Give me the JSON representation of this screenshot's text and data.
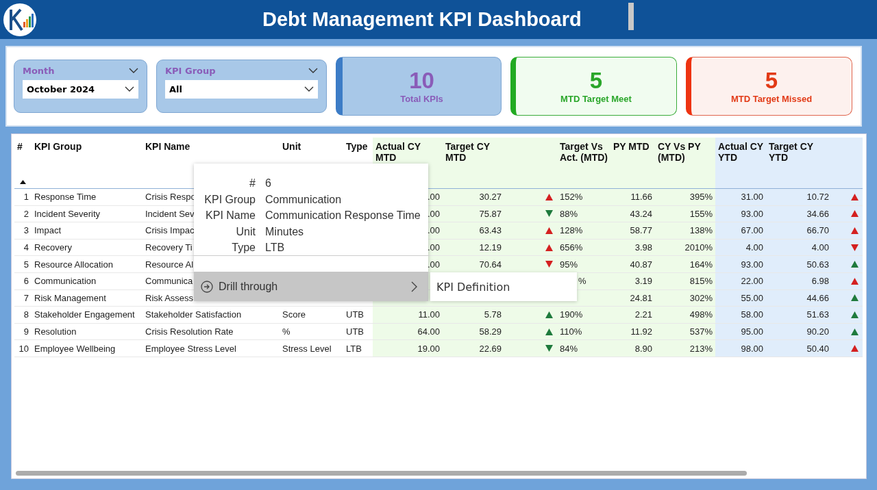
{
  "header": {
    "title": "Debt Management KPI Dashboard"
  },
  "slicers": [
    {
      "label": "Month",
      "value": "October 2024"
    },
    {
      "label": "KPI Group",
      "value": "All"
    }
  ],
  "cards": [
    {
      "kind": "total",
      "value": "10",
      "label": "Total KPIs"
    },
    {
      "kind": "met",
      "value": "5",
      "label": "MTD Target Meet"
    },
    {
      "kind": "missed",
      "value": "5",
      "label": "MTD Target Missed"
    }
  ],
  "table": {
    "columns": [
      {
        "label": "#",
        "sorted": true
      },
      {
        "label": "KPI Group"
      },
      {
        "label": "KPI Name"
      },
      {
        "label": "Unit"
      },
      {
        "label": "Type"
      },
      {
        "label": "Actual CY MTD"
      },
      {
        "label": "Target CY MTD"
      },
      {
        "label": "Target Vs Act. (MTD)"
      },
      {
        "label": "PY MTD"
      },
      {
        "label": "CY Vs PY (MTD)"
      },
      {
        "label": "Actual CY YTD"
      },
      {
        "label": "Target CY YTD"
      }
    ],
    "rows": [
      {
        "num": "1",
        "group": "Response Time",
        "name": "Crisis Respo",
        "actual_mtd": ".00",
        "target_mtd": "30.27",
        "mtd_up": true,
        "mtd_met": false,
        "target_vs_act": "152%",
        "py_mtd": "11.66",
        "cy_vs_py": "395%",
        "actual_ytd": "31.00",
        "target_ytd": "10.72",
        "ytd_up": true,
        "ytd_met": false
      },
      {
        "num": "2",
        "group": "Incident Severity",
        "name": "Incident Sev",
        "actual_mtd": ".00",
        "target_mtd": "75.87",
        "mtd_up": false,
        "mtd_met": true,
        "target_vs_act": "88%",
        "py_mtd": "43.24",
        "cy_vs_py": "155%",
        "actual_ytd": "93.00",
        "target_ytd": "34.66",
        "ytd_up": true,
        "ytd_met": false
      },
      {
        "num": "3",
        "group": "Impact",
        "name": "Crisis Impac",
        "actual_mtd": ".00",
        "target_mtd": "63.43",
        "mtd_up": true,
        "mtd_met": false,
        "target_vs_act": "128%",
        "py_mtd": "58.77",
        "cy_vs_py": "138%",
        "actual_ytd": "67.00",
        "target_ytd": "66.70",
        "ytd_up": true,
        "ytd_met": false
      },
      {
        "num": "4",
        "group": "Recovery",
        "name": "Recovery Ti",
        "actual_mtd": ".00",
        "target_mtd": "12.19",
        "mtd_up": true,
        "mtd_met": false,
        "target_vs_act": "656%",
        "py_mtd": "3.98",
        "cy_vs_py": "2010%",
        "actual_ytd": "4.00",
        "target_ytd": "4.00",
        "ytd_up": false,
        "ytd_met": false
      },
      {
        "num": "5",
        "group": "Resource Allocation",
        "name": "Resource Al",
        "actual_mtd": ".00",
        "target_mtd": "70.64",
        "mtd_up": false,
        "mtd_met": false,
        "target_vs_act": "95%",
        "py_mtd": "40.87",
        "cy_vs_py": "164%",
        "actual_ytd": "93.00",
        "target_ytd": "50.63",
        "ytd_up": true,
        "ytd_met": true
      },
      {
        "num": "6",
        "group": "Communication",
        "name": "Communica",
        "target_vs_act": "%",
        "py_mtd": "3.19",
        "cy_vs_py": "815%",
        "actual_ytd": "22.00",
        "target_ytd": "6.98",
        "ytd_up": true,
        "ytd_met": false
      },
      {
        "num": "7",
        "group": "Risk Management",
        "name": "Risk Assess",
        "py_mtd": "24.81",
        "cy_vs_py": "302%",
        "actual_ytd": "55.00",
        "target_ytd": "44.66",
        "ytd_up": true,
        "ytd_met": true
      },
      {
        "num": "8",
        "group": "Stakeholder Engagement",
        "name": "Stakeholder Satisfaction",
        "unit": "Score",
        "type": "UTB",
        "actual_mtd": "11.00",
        "target_mtd": "5.78",
        "mtd_up": true,
        "mtd_met": true,
        "target_vs_act": "190%",
        "py_mtd": "2.21",
        "cy_vs_py": "498%",
        "actual_ytd": "58.00",
        "target_ytd": "51.63",
        "ytd_up": true,
        "ytd_met": true
      },
      {
        "num": "9",
        "group": "Resolution",
        "name": "Crisis Resolution Rate",
        "unit": "%",
        "type": "UTB",
        "actual_mtd": "64.00",
        "target_mtd": "58.29",
        "mtd_up": true,
        "mtd_met": true,
        "target_vs_act": "110%",
        "py_mtd": "11.92",
        "cy_vs_py": "537%",
        "actual_ytd": "95.00",
        "target_ytd": "90.20",
        "ytd_up": true,
        "ytd_met": true
      },
      {
        "num": "10",
        "group": "Employee Wellbeing",
        "name": "Employee Stress Level",
        "unit": "Stress Level",
        "type": "LTB",
        "actual_mtd": "19.00",
        "target_mtd": "22.69",
        "mtd_up": false,
        "mtd_met": true,
        "target_vs_act": "84%",
        "py_mtd": "8.90",
        "cy_vs_py": "213%",
        "actual_ytd": "98.00",
        "target_ytd": "50.40",
        "ytd_up": true,
        "ytd_met": false
      }
    ]
  },
  "tooltip": {
    "fields": [
      {
        "label": "#",
        "value": "6"
      },
      {
        "label": "KPI Group",
        "value": "Communication"
      },
      {
        "label": "KPI Name",
        "value": "Communication Response Time"
      },
      {
        "label": "Unit",
        "value": "Minutes"
      },
      {
        "label": "Type",
        "value": "LTB"
      }
    ],
    "action": {
      "label": "Drill through",
      "submenu": "KPI Definition"
    }
  }
}
